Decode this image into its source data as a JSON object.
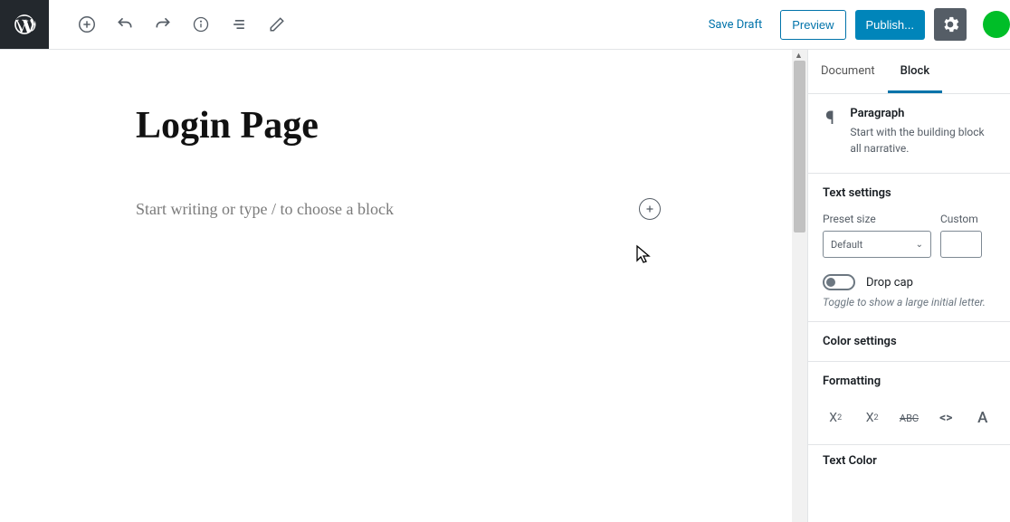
{
  "topbar": {
    "save_draft": "Save Draft",
    "preview": "Preview",
    "publish": "Publish..."
  },
  "editor": {
    "title": "Login Page",
    "placeholder": "Start writing or type / to choose a block"
  },
  "sidebar": {
    "tabs": {
      "document": "Document",
      "block": "Block"
    },
    "block_info": {
      "name": "Paragraph",
      "desc": "Start with the building block all narrative."
    },
    "text_settings": {
      "title": "Text settings",
      "preset_label": "Preset size",
      "preset_value": "Default",
      "custom_label": "Custom",
      "dropcap_label": "Drop cap",
      "dropcap_hint": "Toggle to show a large initial letter."
    },
    "color_settings": {
      "title": "Color settings"
    },
    "formatting": {
      "title": "Formatting"
    },
    "text_color": {
      "title": "Text Color"
    }
  }
}
